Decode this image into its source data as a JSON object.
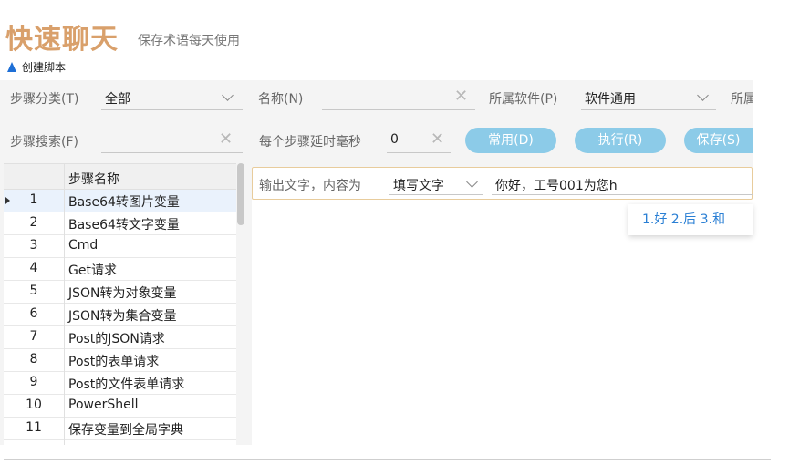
{
  "header": {
    "title": "快速聊天",
    "subtitle": "保存术语每天使用"
  },
  "toolbar": {
    "create_script": "创建脚本"
  },
  "filters": {
    "category_label": "步骤分类(T)",
    "category_value": "全部",
    "name_label": "名称(N)",
    "name_value": "",
    "software_label": "所属软件(P)",
    "software_value": "软件通用",
    "software_label_cut": "所属",
    "search_label": "步骤搜索(F)",
    "search_value": "",
    "delay_label": "每个步骤延时毫秒",
    "delay_value": "0"
  },
  "buttons": {
    "common": "常用(D)",
    "execute": "执行(R)",
    "save": "保存(S)"
  },
  "grid": {
    "column_name": "步骤名称",
    "rows": [
      {
        "num": "1",
        "name": "Base64转图片变量"
      },
      {
        "num": "2",
        "name": "Base64转文字变量"
      },
      {
        "num": "3",
        "name": "Cmd"
      },
      {
        "num": "4",
        "name": "Get请求"
      },
      {
        "num": "5",
        "name": "JSON转为对象变量"
      },
      {
        "num": "6",
        "name": "JSON转为集合变量"
      },
      {
        "num": "7",
        "name": "Post的JSON请求"
      },
      {
        "num": "8",
        "name": "Post的表单请求"
      },
      {
        "num": "9",
        "name": "Post的文件表单请求"
      },
      {
        "num": "10",
        "name": "PowerShell"
      },
      {
        "num": "11",
        "name": "保存变量到全局字典"
      }
    ]
  },
  "step": {
    "label": "输出文字，内容为",
    "mode": "填写文字",
    "text": "你好，工号001为您h"
  },
  "ime": {
    "candidates": "1.好 2.后 3.和"
  },
  "colors": {
    "title": "#d9a06b",
    "accent_button": "#8ccbe8",
    "selected_row": "#eaf2fc",
    "step_border": "#e8cc9c"
  }
}
